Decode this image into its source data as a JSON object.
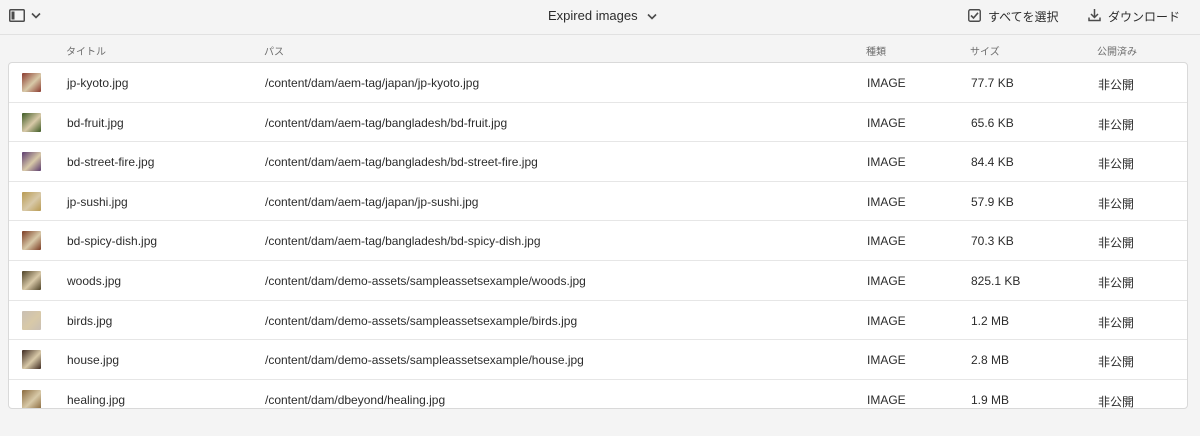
{
  "toolbar": {
    "collection_title": "Expired images",
    "select_all_label": "すべてを選択",
    "download_label": "ダウンロード"
  },
  "columns": {
    "title": "タイトル",
    "path": "パス",
    "type": "種類",
    "size": "サイズ",
    "published": "公開済み"
  },
  "rows": [
    {
      "title": "jp-kyoto.jpg",
      "path": "/content/dam/aem-tag/japan/jp-kyoto.jpg",
      "type": "IMAGE",
      "size": "77.7 KB",
      "published": "非公開",
      "thumb_color": "#8a3a2e"
    },
    {
      "title": "bd-fruit.jpg",
      "path": "/content/dam/aem-tag/bangladesh/bd-fruit.jpg",
      "type": "IMAGE",
      "size": "65.6 KB",
      "published": "非公開",
      "thumb_color": "#3d5a24"
    },
    {
      "title": "bd-street-fire.jpg",
      "path": "/content/dam/aem-tag/bangladesh/bd-street-fire.jpg",
      "type": "IMAGE",
      "size": "84.4 KB",
      "published": "非公開",
      "thumb_color": "#5b3b6e"
    },
    {
      "title": "jp-sushi.jpg",
      "path": "/content/dam/aem-tag/japan/jp-sushi.jpg",
      "type": "IMAGE",
      "size": "57.9 KB",
      "published": "非公開",
      "thumb_color": "#b89a52"
    },
    {
      "title": "bd-spicy-dish.jpg",
      "path": "/content/dam/aem-tag/bangladesh/bd-spicy-dish.jpg",
      "type": "IMAGE",
      "size": "70.3 KB",
      "published": "非公開",
      "thumb_color": "#7a3b22"
    },
    {
      "title": "woods.jpg",
      "path": "/content/dam/demo-assets/sampleassetsexample/woods.jpg",
      "type": "IMAGE",
      "size": "825.1 KB",
      "published": "非公開",
      "thumb_color": "#4e4126"
    },
    {
      "title": "birds.jpg",
      "path": "/content/dam/demo-assets/sampleassetsexample/birds.jpg",
      "type": "IMAGE",
      "size": "1.2 MB",
      "published": "非公開",
      "thumb_color": "#c9bfb4"
    },
    {
      "title": "house.jpg",
      "path": "/content/dam/demo-assets/sampleassetsexample/house.jpg",
      "type": "IMAGE",
      "size": "2.8 MB",
      "published": "非公開",
      "thumb_color": "#3e2a20"
    },
    {
      "title": "healing.jpg",
      "path": "/content/dam/dbeyond/healing.jpg",
      "type": "IMAGE",
      "size": "1.9 MB",
      "published": "非公開",
      "thumb_color": "#8a6a3e"
    }
  ]
}
